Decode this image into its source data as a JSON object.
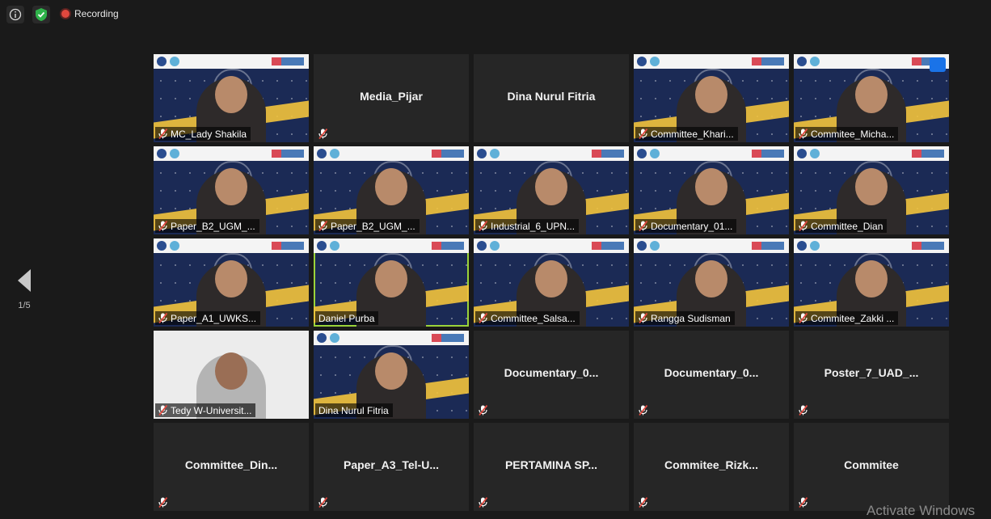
{
  "top_bar": {
    "info_icon": "info-icon",
    "security_icon": "shield-check-icon",
    "recording_label": "Recording"
  },
  "pager": {
    "page_indicator": "1/5"
  },
  "participants": [
    {
      "name": "MC_Lady Shakila",
      "kind": "video",
      "muted": true
    },
    {
      "name": "Media_Pijar",
      "kind": "name",
      "muted": true
    },
    {
      "name": "Dina Nurul Fitria",
      "kind": "name",
      "muted": false
    },
    {
      "name": "Committee_Khari...",
      "kind": "video",
      "muted": true
    },
    {
      "name": "Commitee_Micha...",
      "kind": "video",
      "muted": true
    },
    {
      "name": "Paper_B2_UGM_...",
      "kind": "video",
      "muted": true
    },
    {
      "name": "Paper_B2_UGM_...",
      "kind": "video",
      "muted": true
    },
    {
      "name": "Industrial_6_UPN...",
      "kind": "video",
      "muted": true
    },
    {
      "name": "Documentary_01...",
      "kind": "video",
      "muted": true
    },
    {
      "name": "Committee_Dian",
      "kind": "video",
      "muted": true
    },
    {
      "name": "Paper_A1_UWKS...",
      "kind": "video",
      "muted": true
    },
    {
      "name": "Daniel Purba",
      "kind": "video",
      "muted": false,
      "active": true
    },
    {
      "name": "Committee_Salsa...",
      "kind": "video",
      "muted": true
    },
    {
      "name": "Rangga Sudisman",
      "kind": "video",
      "muted": true
    },
    {
      "name": "Commitee_Zakki ...",
      "kind": "video",
      "muted": true
    },
    {
      "name": "Tedy W-Universit...",
      "kind": "white",
      "muted": true
    },
    {
      "name": "Dina Nurul Fitria",
      "kind": "video",
      "muted": false
    },
    {
      "name": "Documentary_0...",
      "kind": "name",
      "muted": true
    },
    {
      "name": "Documentary_0...",
      "kind": "name",
      "muted": true
    },
    {
      "name": "Poster_7_UAD_...",
      "kind": "name",
      "muted": true
    },
    {
      "name": "Committee_Din...",
      "kind": "name",
      "muted": true
    },
    {
      "name": "Paper_A3_Tel-U...",
      "kind": "name",
      "muted": true
    },
    {
      "name": "PERTAMINA SP...",
      "kind": "name",
      "muted": true
    },
    {
      "name": "Commitee_Rizk...",
      "kind": "name",
      "muted": true
    },
    {
      "name": "Commitee",
      "kind": "name",
      "muted": true
    }
  ],
  "watermark": "Activate Windows",
  "colors": {
    "accent_active": "#9bd33a",
    "muted_red": "#e0483e",
    "recording": "#e0483e"
  }
}
